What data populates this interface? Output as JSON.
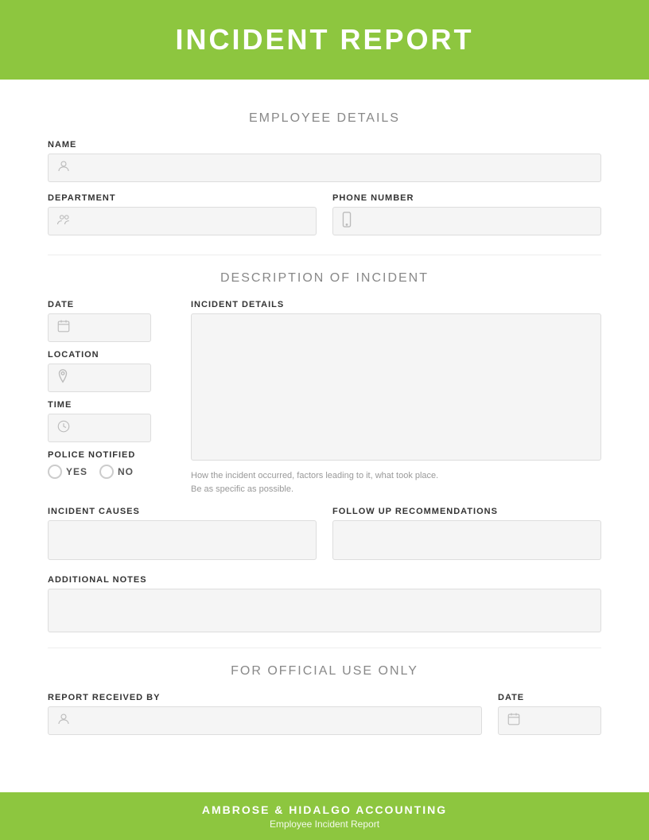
{
  "header": {
    "title": "INCIDENT REPORT"
  },
  "employee_details": {
    "section_title": "EMPLOYEE DETAILS",
    "name_label": "NAME",
    "department_label": "DEPARTMENT",
    "phone_label": "PHONE NUMBER"
  },
  "description": {
    "section_title": "DESCRIPTION OF INCIDENT",
    "date_label": "DATE",
    "location_label": "LOCATION",
    "time_label": "TIME",
    "police_label": "POLICE NOTIFIED",
    "yes_label": "YES",
    "no_label": "NO",
    "incident_details_label": "INCIDENT DETAILS",
    "incident_hint_line1": "How the incident occurred, factors leading to it, what took place.",
    "incident_hint_line2": "Be as specific as possible.",
    "incident_causes_label": "INCIDENT CAUSES",
    "followup_label": "FOLLOW UP RECOMMENDATIONS",
    "additional_notes_label": "ADDITIONAL NOTES"
  },
  "official": {
    "section_title": "FOR OFFICIAL USE ONLY",
    "report_received_label": "REPORT RECEIVED BY",
    "date_label": "DATE"
  },
  "footer": {
    "company": "AMBROSE & HIDALGO ACCOUNTING",
    "subtitle": "Employee Incident Report"
  },
  "icons": {
    "person": "👤",
    "department": "👥",
    "phone": "📱",
    "calendar": "📅",
    "location": "📍",
    "time": "🕐"
  }
}
